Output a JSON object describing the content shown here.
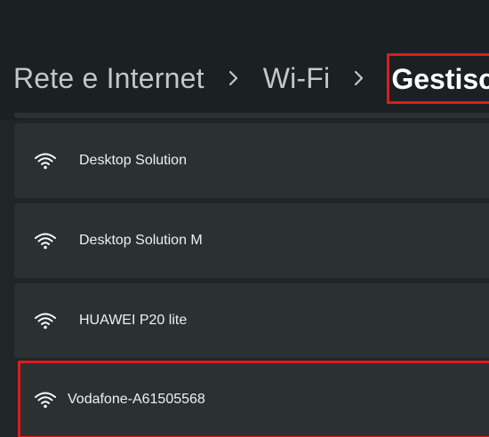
{
  "breadcrumb": {
    "items": [
      "Rete e Internet",
      "Wi-Fi"
    ],
    "current": "Gestisc"
  },
  "networks": [
    {
      "name": "Desktop Solution",
      "icon": "wifi-icon"
    },
    {
      "name": "Desktop Solution M",
      "icon": "wifi-icon"
    },
    {
      "name": "HUAWEI P20 lite",
      "icon": "wifi-icon"
    },
    {
      "name": "Vodafone-A61505568",
      "icon": "wifi-icon"
    }
  ],
  "colors": {
    "background": "#202528",
    "card": "#2b3033",
    "highlight": "#e01b1b",
    "text": "#eef0f1"
  }
}
